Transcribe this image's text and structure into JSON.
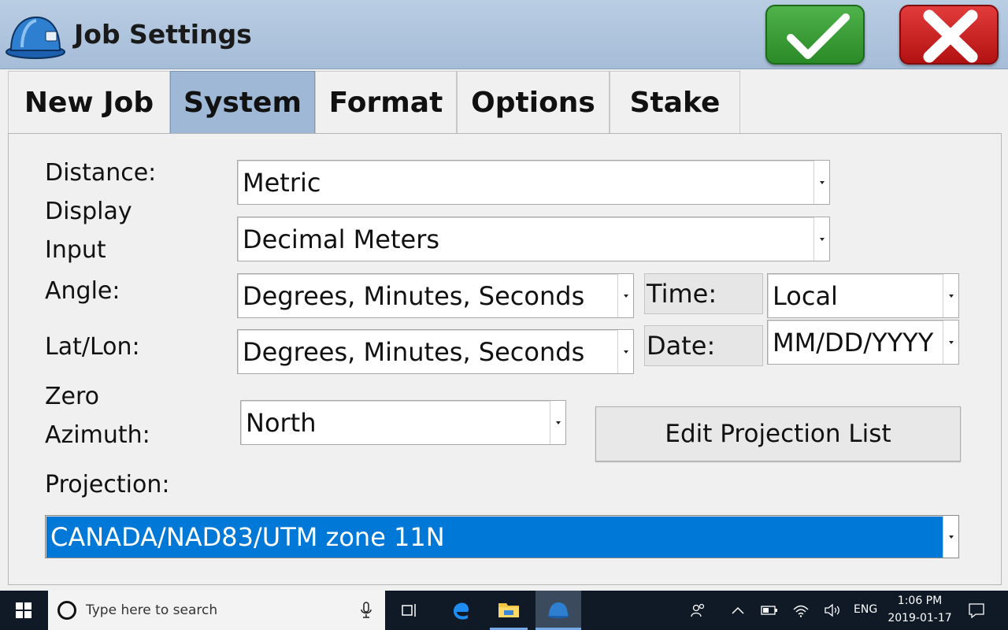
{
  "window": {
    "title": "Job Settings",
    "ok_icon": "checkmark-icon",
    "cancel_icon": "x-icon"
  },
  "tabs": [
    {
      "label": "New Job",
      "active": false
    },
    {
      "label": "System",
      "active": true
    },
    {
      "label": "Format",
      "active": false
    },
    {
      "label": "Options",
      "active": false
    },
    {
      "label": "Stake",
      "active": false
    }
  ],
  "form": {
    "distance_label": "Distance:",
    "display_label": "Display",
    "input_label": "Input",
    "distance_display_value": "Metric",
    "distance_input_value": "Decimal Meters",
    "angle_label": "Angle:",
    "angle_value": "Degrees, Minutes, Seconds",
    "time_label": "Time:",
    "time_value": "Local",
    "latlon_label": "Lat/Lon:",
    "latlon_value": "Degrees, Minutes, Seconds",
    "date_label": "Date:",
    "date_value": "MM/DD/YYYY",
    "zero_label": "Zero",
    "azimuth_label": "Azimuth:",
    "zero_azimuth_value": "North",
    "edit_projection_button": "Edit Projection List",
    "projection_label": "Projection:",
    "projection_value": "CANADA/NAD83/UTM zone 11N"
  },
  "taskbar": {
    "search_placeholder": "Type here to search",
    "language": "ENG",
    "time": "1:06 PM",
    "date": "2019-01-17"
  },
  "colors": {
    "titlebar": "#b3c8df",
    "active_tab": "#9fb8d6",
    "selection": "#0078d7",
    "ok_green": "#3a9e35",
    "cancel_red": "#cc1f1f",
    "taskbar": "#101a26"
  }
}
